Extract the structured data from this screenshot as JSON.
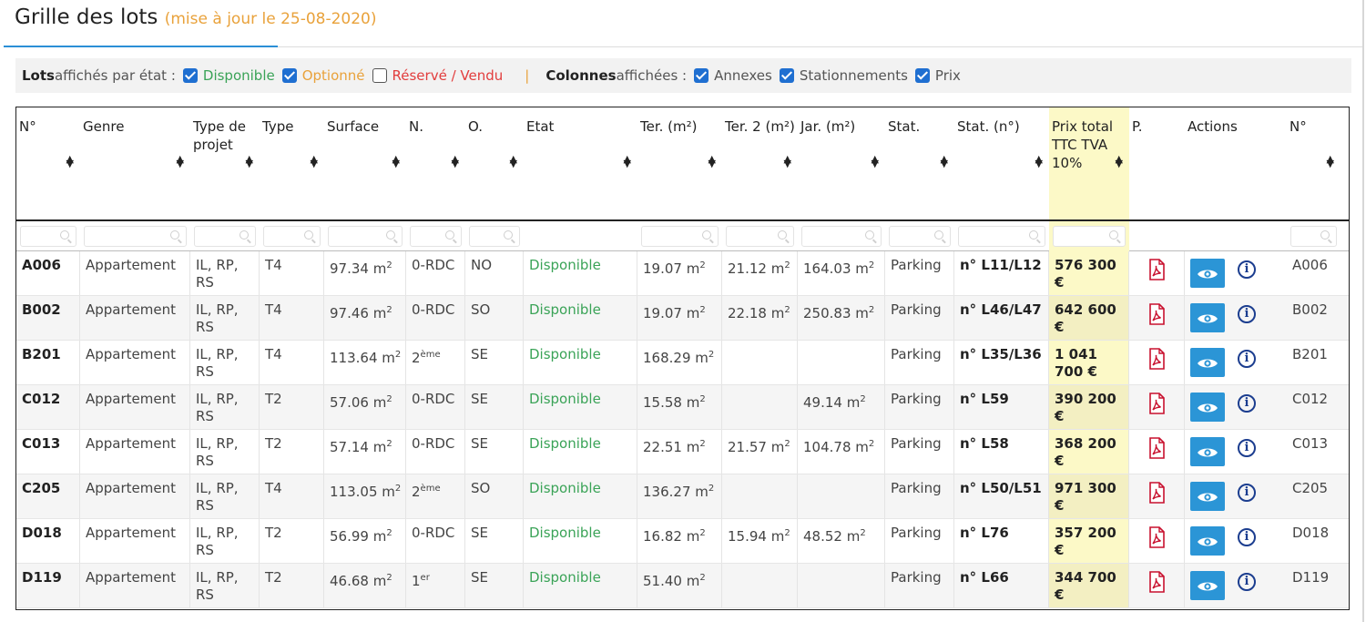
{
  "page": {
    "title": "Grille des lots",
    "subtitle": "(mise à jour le 25-08-2020)"
  },
  "filters": {
    "lots_label_bold": "Lots",
    "lots_label_rest": " affichés par état :",
    "states": [
      {
        "label": "Disponible",
        "checked": true,
        "color": "#3aa357"
      },
      {
        "label": "Optionné",
        "checked": true,
        "color": "#e9a23b"
      },
      {
        "label": "Réservé / Vendu",
        "checked": false,
        "color": "#e23d3d"
      }
    ],
    "separator": "|",
    "columns_label_bold": "Colonnes",
    "columns_label_rest": " affichées :",
    "columns": [
      {
        "label": "Annexes",
        "checked": true
      },
      {
        "label": "Stationnements",
        "checked": true
      },
      {
        "label": "Prix",
        "checked": true
      }
    ]
  },
  "table": {
    "headers": [
      "N°",
      "Genre",
      "Type de projet",
      "Type",
      "Surface",
      "N.",
      "O.",
      "Etat",
      "Ter. (m²)",
      "Ter. 2 (m²)",
      "Jar. (m²)",
      "Stat.",
      "Stat. (n°)",
      "Prix total TTC TVA 10%",
      "P.",
      "Actions",
      "N°"
    ],
    "sortable": [
      true,
      true,
      true,
      true,
      true,
      true,
      true,
      true,
      true,
      true,
      true,
      true,
      true,
      true,
      false,
      false,
      true
    ],
    "filterable": [
      true,
      true,
      true,
      true,
      true,
      true,
      true,
      false,
      true,
      true,
      true,
      true,
      true,
      true,
      false,
      false,
      true
    ],
    "rows": [
      {
        "num": "A006",
        "genre": "Appartement",
        "projet": "IL, RP, RS",
        "type": "T4",
        "surface": "97.34 m",
        "niveau": "0-RDC",
        "niveau_sup": "",
        "orient": "NO",
        "etat": "Disponible",
        "ter": "19.07 m",
        "ter2": "21.12 m",
        "jar": "164.03 m",
        "stat": "Parking",
        "statn": "n° L11/L12",
        "prix": "576 300 €"
      },
      {
        "num": "B002",
        "genre": "Appartement",
        "projet": "IL, RP, RS",
        "type": "T4",
        "surface": "97.46 m",
        "niveau": "0-RDC",
        "niveau_sup": "",
        "orient": "SO",
        "etat": "Disponible",
        "ter": "19.07 m",
        "ter2": "22.18 m",
        "jar": "250.83 m",
        "stat": "Parking",
        "statn": "n° L46/L47",
        "prix": "642 600 €"
      },
      {
        "num": "B201",
        "genre": "Appartement",
        "projet": "IL, RP, RS",
        "type": "T4",
        "surface": "113.64 m",
        "niveau": "2",
        "niveau_sup": "ème",
        "orient": "SE",
        "etat": "Disponible",
        "ter": "168.29 m",
        "ter2": "",
        "jar": "",
        "stat": "Parking",
        "statn": "n° L35/L36",
        "prix": "1 041 700 €"
      },
      {
        "num": "C012",
        "genre": "Appartement",
        "projet": "IL, RP, RS",
        "type": "T2",
        "surface": "57.06 m",
        "niveau": "0-RDC",
        "niveau_sup": "",
        "orient": "SE",
        "etat": "Disponible",
        "ter": "15.58 m",
        "ter2": "",
        "jar": "49.14 m",
        "stat": "Parking",
        "statn": "n° L59",
        "prix": "390 200 €"
      },
      {
        "num": "C013",
        "genre": "Appartement",
        "projet": "IL, RP, RS",
        "type": "T2",
        "surface": "57.14 m",
        "niveau": "0-RDC",
        "niveau_sup": "",
        "orient": "SE",
        "etat": "Disponible",
        "ter": "22.51 m",
        "ter2": "21.57 m",
        "jar": "104.78 m",
        "stat": "Parking",
        "statn": "n° L58",
        "prix": "368 200 €"
      },
      {
        "num": "C205",
        "genre": "Appartement",
        "projet": "IL, RP, RS",
        "type": "T4",
        "surface": "113.05 m",
        "niveau": "2",
        "niveau_sup": "ème",
        "orient": "SO",
        "etat": "Disponible",
        "ter": "136.27 m",
        "ter2": "",
        "jar": "",
        "stat": "Parking",
        "statn": "n° L50/L51",
        "prix": "971 300 €"
      },
      {
        "num": "D018",
        "genre": "Appartement",
        "projet": "IL, RP, RS",
        "type": "T2",
        "surface": "56.99 m",
        "niveau": "0-RDC",
        "niveau_sup": "",
        "orient": "SE",
        "etat": "Disponible",
        "ter": "16.82 m",
        "ter2": "15.94 m",
        "jar": "48.52 m",
        "stat": "Parking",
        "statn": "n° L76",
        "prix": "357 200 €"
      },
      {
        "num": "D119",
        "genre": "Appartement",
        "projet": "IL, RP, RS",
        "type": "T2",
        "surface": "46.68 m",
        "niveau": "1",
        "niveau_sup": "er",
        "orient": "SE",
        "etat": "Disponible",
        "ter": "51.40 m",
        "ter2": "",
        "jar": "",
        "stat": "Parking",
        "statn": "n° L66",
        "prix": "344 700 €"
      }
    ],
    "icons": {
      "pdf": "pdf-icon",
      "view": "eye-icon",
      "info": "info-icon",
      "filter": "search-icon",
      "sort": "sort-icon"
    },
    "colors": {
      "accent": "#2b8fd6",
      "dispo": "#3aa357",
      "prix_bg": "#fcf9c7",
      "info": "#1b3d8f"
    }
  }
}
